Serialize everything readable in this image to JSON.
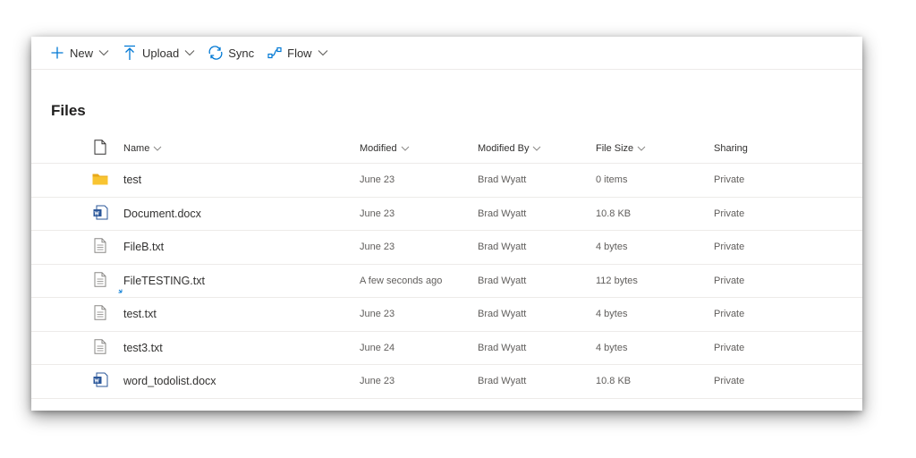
{
  "toolbar": {
    "new_label": "New",
    "upload_label": "Upload",
    "sync_label": "Sync",
    "flow_label": "Flow"
  },
  "page": {
    "title": "Files"
  },
  "columns": {
    "name": "Name",
    "modified": "Modified",
    "modified_by": "Modified By",
    "file_size": "File Size",
    "sharing": "Sharing"
  },
  "files": [
    {
      "name": "test",
      "icon": "folder-icon",
      "modified": "June 23",
      "modified_by": "Brad Wyatt",
      "size": "0 items",
      "sharing": "Private"
    },
    {
      "name": "Document.docx",
      "icon": "word-icon",
      "modified": "June 23",
      "modified_by": "Brad Wyatt",
      "size": "10.8 KB",
      "sharing": "Private"
    },
    {
      "name": "FileB.txt",
      "icon": "text-file-icon",
      "modified": "June 23",
      "modified_by": "Brad Wyatt",
      "size": "4 bytes",
      "sharing": "Private"
    },
    {
      "name": "FileTESTING.txt",
      "icon": "text-file-icon",
      "modified": "A few seconds ago",
      "modified_by": "Brad Wyatt",
      "size": "112 bytes",
      "sharing": "Private"
    },
    {
      "name": "test.txt",
      "icon": "text-file-icon",
      "modified": "June 23",
      "modified_by": "Brad Wyatt",
      "size": "4 bytes",
      "sharing": "Private"
    },
    {
      "name": "test3.txt",
      "icon": "text-file-icon",
      "modified": "June 24",
      "modified_by": "Brad Wyatt",
      "size": "4 bytes",
      "sharing": "Private"
    },
    {
      "name": "word_todolist.docx",
      "icon": "word-icon",
      "modified": "June 23",
      "modified_by": "Brad Wyatt",
      "size": "10.8 KB",
      "sharing": "Private"
    }
  ],
  "colors": {
    "accent": "#0078d4",
    "folder": "#f8c431",
    "word": "#2b579a"
  }
}
